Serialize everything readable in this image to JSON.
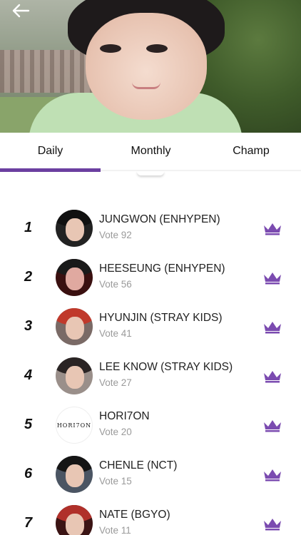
{
  "header": {
    "back_icon": "arrow-left-icon",
    "photo": "artist-photo"
  },
  "tabs": [
    {
      "label": "Daily",
      "active": true
    },
    {
      "label": "Monthly",
      "active": false
    },
    {
      "label": "Champ",
      "active": false
    }
  ],
  "colors": {
    "accent": "#6b3fa0",
    "crown": "#7b4bb0"
  },
  "ranking": [
    {
      "rank": "1",
      "name": "JUNGWON (ENHYPEN)",
      "votes": "Vote 92",
      "avatar": "artist-avatar",
      "icon": "crown-icon"
    },
    {
      "rank": "2",
      "name": "HEESEUNG (ENHYPEN)",
      "votes": "Vote 56",
      "avatar": "artist-avatar",
      "icon": "crown-icon"
    },
    {
      "rank": "3",
      "name": "HYUNJIN (STRAY KIDS)",
      "votes": "Vote 41",
      "avatar": "artist-avatar",
      "icon": "crown-icon"
    },
    {
      "rank": "4",
      "name": "LEE KNOW (STRAY KIDS)",
      "votes": "Vote 27",
      "avatar": "artist-avatar",
      "icon": "crown-icon"
    },
    {
      "rank": "5",
      "name": "HORI7ON",
      "votes": "Vote 20",
      "avatar": "group-logo",
      "logo_text": "HORI7ON",
      "icon": "crown-icon"
    },
    {
      "rank": "6",
      "name": "CHENLE (NCT)",
      "votes": "Vote 15",
      "avatar": "artist-avatar",
      "icon": "crown-icon"
    },
    {
      "rank": "7",
      "name": "NATE (BGYO)",
      "votes": "Vote 11",
      "avatar": "artist-avatar",
      "icon": "crown-icon"
    }
  ]
}
